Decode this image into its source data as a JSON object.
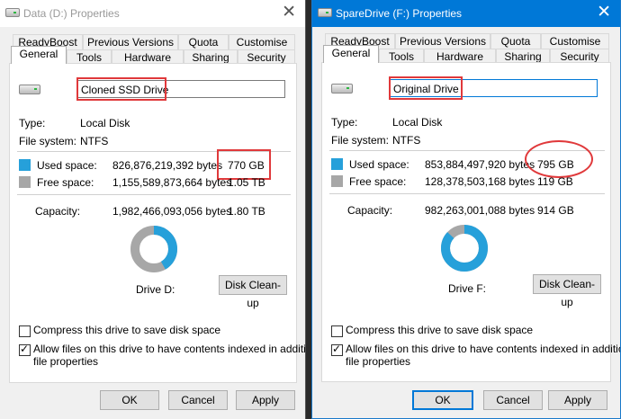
{
  "left": {
    "title": "Data (D:) Properties",
    "tabs_row1": [
      "ReadyBoost",
      "Previous Versions",
      "Quota",
      "Customise"
    ],
    "tabs_row2": [
      "General",
      "Tools",
      "Hardware",
      "Sharing",
      "Security"
    ],
    "active_tab": "General",
    "drive_name": "Cloned SSD Drive",
    "type_label": "Type:",
    "type_value": "Local Disk",
    "fs_label": "File system:",
    "fs_value": "NTFS",
    "used_label": "Used space:",
    "used_bytes": "826,876,219,392 bytes",
    "used_human": "770 GB",
    "free_label": "Free space:",
    "free_bytes": "1,155,589,873,664 bytes",
    "free_human": "1.05 TB",
    "capacity_label": "Capacity:",
    "capacity_bytes": "1,982,466,093,056 bytes",
    "capacity_human": "1.80 TB",
    "used_fraction": 0.417,
    "drive_label": "Drive D:",
    "cleanup_label": "Disk Clean-up",
    "compress_label": "Compress this drive to save disk space",
    "compress_checked": false,
    "index_label_1": "Allow files on this drive to have contents indexed in addition to",
    "index_label_2": "file properties",
    "index_checked": true,
    "ok_label": "OK",
    "cancel_label": "Cancel",
    "apply_label": "Apply"
  },
  "right": {
    "title": "SpareDrive (F:) Properties",
    "tabs_row1": [
      "ReadyBoost",
      "Previous Versions",
      "Quota",
      "Customise"
    ],
    "tabs_row2": [
      "General",
      "Tools",
      "Hardware",
      "Sharing",
      "Security"
    ],
    "active_tab": "General",
    "drive_name": "Original Drive",
    "type_label": "Type:",
    "type_value": "Local Disk",
    "fs_label": "File system:",
    "fs_value": "NTFS",
    "used_label": "Used space:",
    "used_bytes": "853,884,497,920 bytes",
    "used_human": "795 GB",
    "free_label": "Free space:",
    "free_bytes": "128,378,503,168 bytes",
    "free_human": "119 GB",
    "capacity_label": "Capacity:",
    "capacity_bytes": "982,263,001,088 bytes",
    "capacity_human": "914 GB",
    "used_fraction": 0.869,
    "drive_label": "Drive F:",
    "cleanup_label": "Disk Clean-up",
    "compress_label": "Compress this drive to save disk space",
    "compress_checked": false,
    "index_label_1": "Allow files on this drive to have contents indexed in addition to",
    "index_label_2": "file properties",
    "index_checked": true,
    "ok_label": "OK",
    "cancel_label": "Cancel",
    "apply_label": "Apply"
  },
  "colors": {
    "used": "#26a0da",
    "free": "#a7a7a7",
    "accent": "#0078d7",
    "annotation": "#e0393b"
  },
  "icons": {
    "close": "close-icon",
    "drive": "drive-icon",
    "app": "drive-app-icon"
  }
}
